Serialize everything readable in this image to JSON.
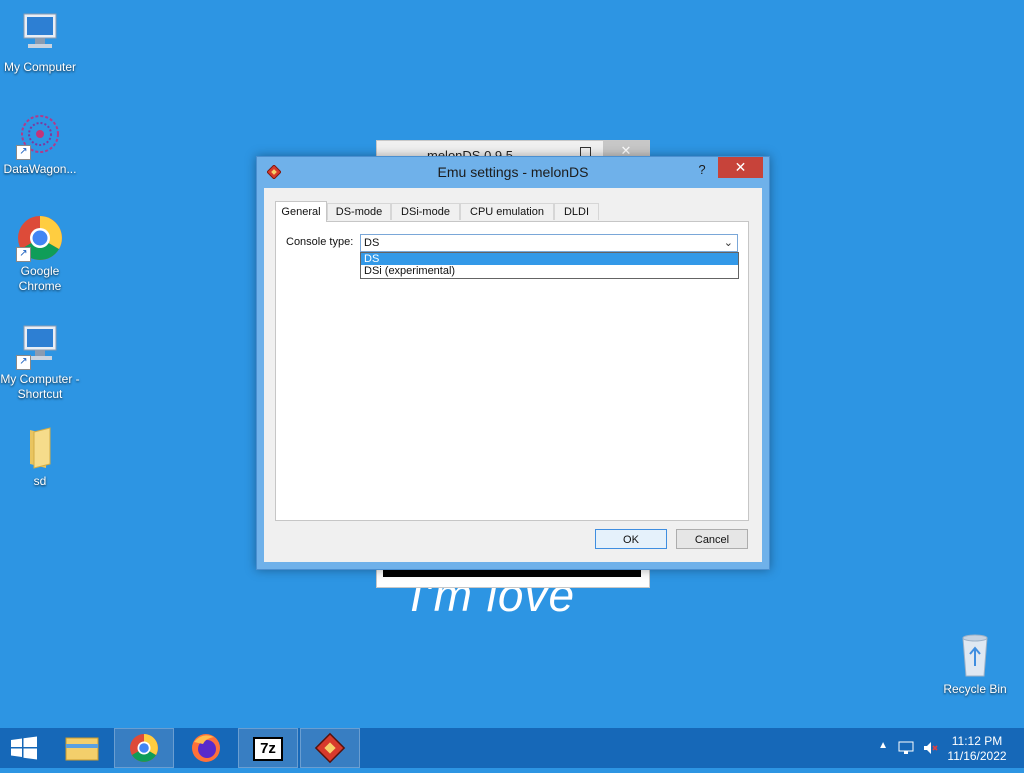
{
  "desktop": {
    "icons": [
      {
        "label": "My Computer"
      },
      {
        "label": "DataWagon..."
      },
      {
        "label": "Google Chrome"
      },
      {
        "label": "My Computer - Shortcut"
      },
      {
        "label": "sd"
      },
      {
        "label": "Recycle Bin"
      }
    ],
    "wallpaper_text": "I'm love"
  },
  "background_window": {
    "title": "melonDS 0.9.5"
  },
  "dialog": {
    "title": "Emu settings - melonDS",
    "help_label": "?",
    "close_label": "✕",
    "tabs": [
      {
        "label": "General",
        "active": true
      },
      {
        "label": "DS-mode",
        "active": false
      },
      {
        "label": "DSi-mode",
        "active": false
      },
      {
        "label": "CPU emulation",
        "active": false
      },
      {
        "label": "DLDI",
        "active": false
      }
    ],
    "console_type": {
      "label": "Console type:",
      "value": "DS",
      "options": [
        "DS",
        "DSi (experimental)"
      ],
      "highlighted": "DS"
    },
    "ok_label": "OK",
    "cancel_label": "Cancel"
  },
  "taskbar": {
    "items": [
      {
        "icon": "windows-start-icon"
      },
      {
        "icon": "file-explorer-icon"
      },
      {
        "icon": "chrome-icon"
      },
      {
        "icon": "firefox-icon"
      },
      {
        "icon": "7zip-icon",
        "text": "7z"
      },
      {
        "icon": "melonds-icon"
      }
    ],
    "clock_time": "11:12 PM",
    "clock_date": "11/16/2022"
  },
  "colors": {
    "desktop": "#2d95e3",
    "taskbar": "#1668b8",
    "accent": "#3399e8",
    "close": "#c7433a"
  }
}
